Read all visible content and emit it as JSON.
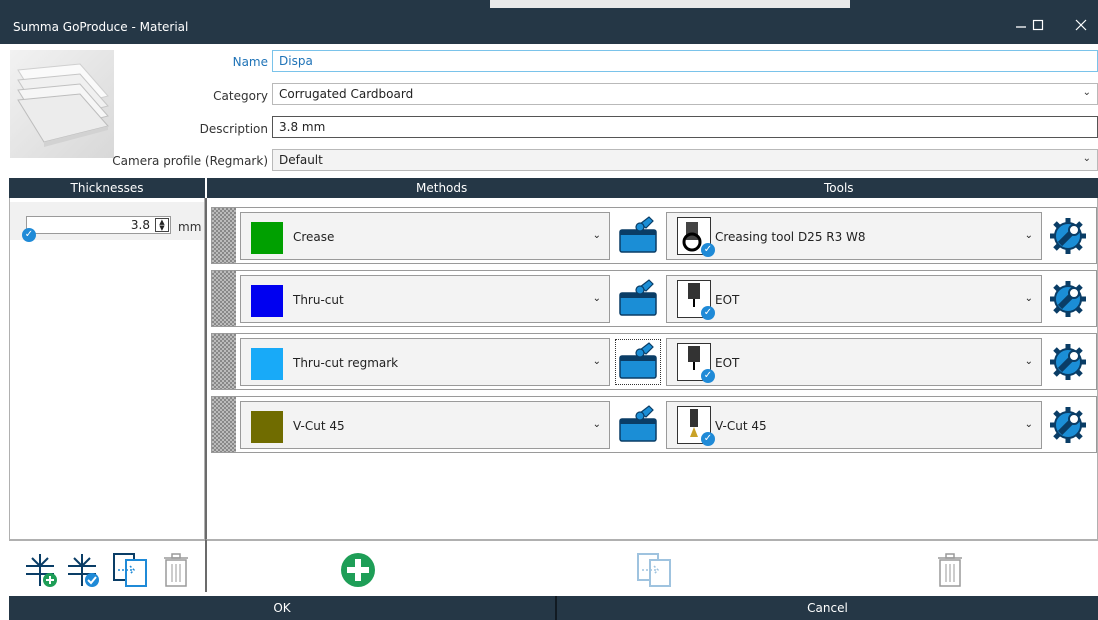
{
  "window": {
    "title": "Summa GoProduce - Material"
  },
  "form": {
    "name_label": "Name",
    "name_value": "Dispa",
    "category_label": "Category",
    "category_value": "Corrugated Cardboard",
    "description_label": "Description",
    "description_value": "3.8 mm",
    "camera_label": "Camera profile (Regmark)",
    "camera_value": "Default"
  },
  "headers": {
    "thicknesses": "Thicknesses",
    "methods": "Methods",
    "tools": "Tools"
  },
  "thickness": {
    "value": "3.8",
    "unit": "mm"
  },
  "rows": [
    {
      "method": "Crease",
      "color": "#00a000",
      "tool": "Creasing tool D25 R3 W8"
    },
    {
      "method": "Thru-cut",
      "color": "#0000f0",
      "tool": "EOT"
    },
    {
      "method": "Thru-cut regmark",
      "color": "#18aaf8",
      "tool": "EOT"
    },
    {
      "method": "V-Cut 45",
      "color": "#706c00",
      "tool": "V-Cut 45"
    }
  ],
  "footer": {
    "ok": "OK",
    "cancel": "Cancel"
  },
  "colors": {
    "titlebar": "#253746",
    "accent": "#1f8ad7",
    "add_green": "#1e9e57"
  }
}
